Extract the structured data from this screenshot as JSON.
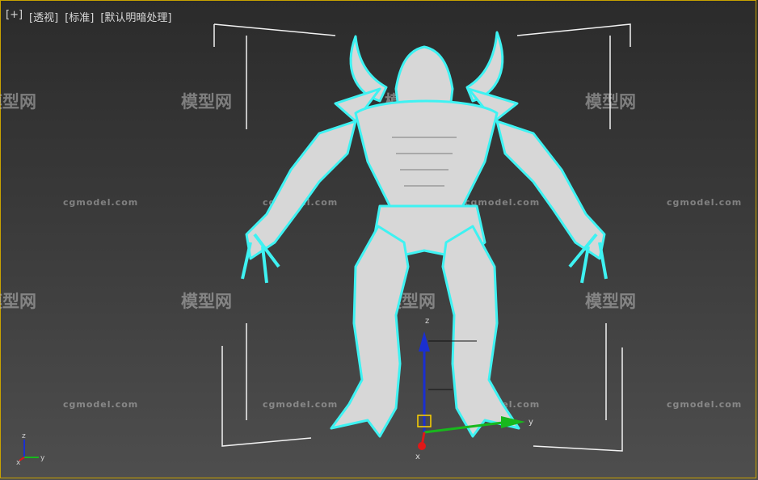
{
  "viewport": {
    "labels": [
      "[+]",
      "[透视]",
      "[标准]",
      "[默认明暗处理]"
    ]
  },
  "watermark": {
    "brand_cn": "模型网",
    "brand_en": "cgmodel.com"
  },
  "gizmo": {
    "z_axis": "z",
    "y_axis": "y",
    "x_axis": "x"
  },
  "colors": {
    "selection_outline": "#3ef2f2",
    "model_fill": "#d7d7d7",
    "axis_z": "#1a2fd1",
    "axis_x": "#e01818",
    "axis_y": "#18b81d",
    "active_border": "#c8a200"
  }
}
